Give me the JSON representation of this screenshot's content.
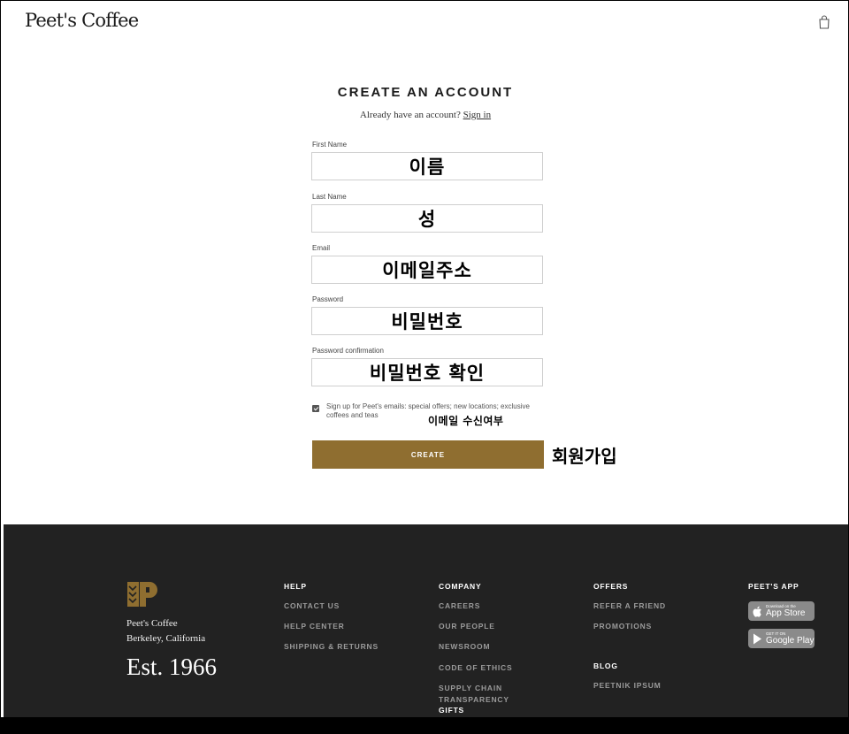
{
  "header": {
    "logo_text": "Peet's Coffee",
    "cart_icon": "shopping-bag-icon"
  },
  "form": {
    "title": "CREATE AN ACCOUNT",
    "signin_prompt": "Already have an account?",
    "signin_link": "Sign in",
    "fields": [
      {
        "label": "First Name",
        "annotation": "이름"
      },
      {
        "label": "Last Name",
        "annotation": "성"
      },
      {
        "label": "Email",
        "annotation": "이메일주소"
      },
      {
        "label": "Password",
        "annotation": "비밀번호"
      },
      {
        "label": "Password confirmation",
        "annotation": "비밀번호 확인"
      }
    ],
    "consent_checked": true,
    "consent_text": "Sign up for Peet's emails: special offers; new locations; exclusive coffees and teas",
    "consent_annotation": "이메일 수신여부",
    "submit_label": "CREATE",
    "submit_annotation": "회원가입",
    "accent_color": "#8f6e30"
  },
  "footer": {
    "brand_name": "Peet's Coffee",
    "brand_location": "Berkeley, California",
    "established": "Est. 1966",
    "help": {
      "heading": "HELP",
      "links": [
        "CONTACT US",
        "HELP CENTER",
        "SHIPPING & RETURNS"
      ]
    },
    "company": {
      "heading": "COMPANY",
      "links": [
        "CAREERS",
        "OUR PEOPLE",
        "NEWSROOM",
        "CODE OF ETHICS",
        "SUPPLY CHAIN TRANSPARENCY",
        "GIFTS"
      ]
    },
    "offers": {
      "heading": "OFFERS",
      "links": [
        "REFER A FRIEND",
        "PROMOTIONS"
      ]
    },
    "blog": {
      "heading": "BLOG",
      "links": [
        "PEETNIK IPSUM"
      ]
    },
    "app": {
      "heading": "PEET'S APP",
      "app_store_small": "Download on the",
      "app_store_big": "App Store",
      "google_play_small": "GET IT ON",
      "google_play_big": "Google Play"
    },
    "background_color": "#222222"
  }
}
